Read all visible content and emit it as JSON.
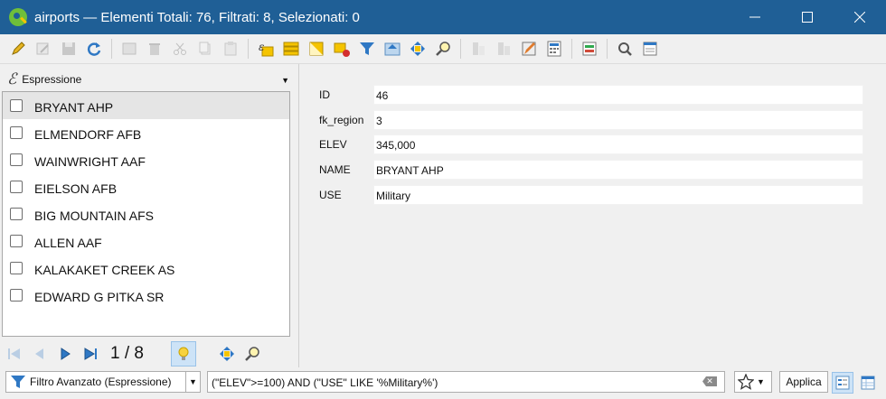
{
  "window": {
    "title": "airports — Elementi Totali: 76,  Filtrati: 8, Selezionati: 0",
    "minimize_label": "—",
    "maximize_label": "☐",
    "close_label": "✕"
  },
  "expression_picker": {
    "label": "Espressione"
  },
  "list": {
    "items": [
      "BRYANT AHP",
      "ELMENDORF AFB",
      "WAINWRIGHT AAF",
      "EIELSON AFB",
      "BIG MOUNTAIN AFS",
      "ALLEN AAF",
      "KALAKAKET CREEK  AS",
      "EDWARD G PITKA SR"
    ],
    "selected_index": 0
  },
  "pager": {
    "text": "1 / 8"
  },
  "form": {
    "fields": [
      {
        "label": "ID",
        "value": "46"
      },
      {
        "label": "fk_region",
        "value": "3"
      },
      {
        "label": "ELEV",
        "value": "345,000"
      },
      {
        "label": "NAME",
        "value": "BRYANT AHP"
      },
      {
        "label": "USE",
        "value": "Military"
      }
    ]
  },
  "filter": {
    "mode_label": "Filtro Avanzato (Espressione)",
    "expression": "(\"ELEV\">=100) AND (\"USE\" LIKE '%Military%')",
    "apply_label": "Applica"
  }
}
